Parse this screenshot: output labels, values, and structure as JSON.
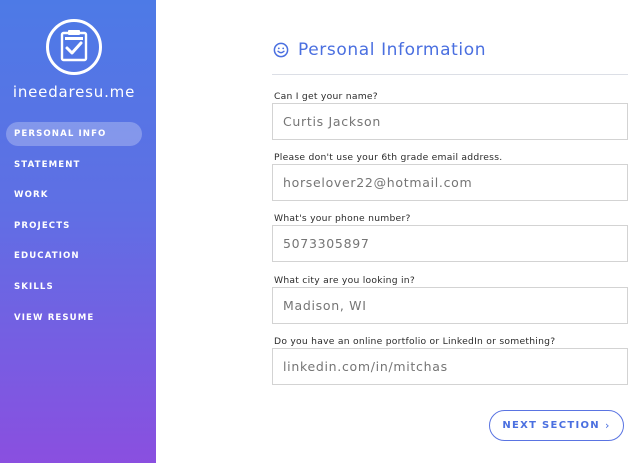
{
  "brand": {
    "name": "ineedaresu.me",
    "logo_icon": "clipboard-check-icon"
  },
  "sidebar": {
    "items": [
      {
        "label": "PERSONAL INFO",
        "active": true
      },
      {
        "label": "STATEMENT"
      },
      {
        "label": "WORK"
      },
      {
        "label": "PROJECTS"
      },
      {
        "label": "EDUCATION"
      },
      {
        "label": "SKILLS"
      },
      {
        "label": "VIEW RESUME"
      }
    ]
  },
  "header": {
    "title": "Personal Information",
    "icon": "smiley-icon"
  },
  "form": {
    "fields": [
      {
        "label": "Can I get your name?",
        "placeholder": "Curtis Jackson",
        "value": ""
      },
      {
        "label": "Please don't use your 6th grade email address.",
        "placeholder": "horselover22@hotmail.com",
        "value": ""
      },
      {
        "label": "What's your phone number?",
        "placeholder": "5073305897",
        "value": ""
      },
      {
        "label": "What city are you looking in?",
        "placeholder": "Madison, WI",
        "value": ""
      },
      {
        "label": "Do you have an online portfolio or LinkedIn or something?",
        "placeholder": "linkedin.com/in/mitchas",
        "value": ""
      }
    ]
  },
  "next_button": {
    "label": "NEXT SECTION",
    "chevron": "›"
  },
  "colors": {
    "accent": "#4a6fe0",
    "sidebar_top": "#4d7ae6",
    "sidebar_bottom": "#8a4fe0"
  }
}
